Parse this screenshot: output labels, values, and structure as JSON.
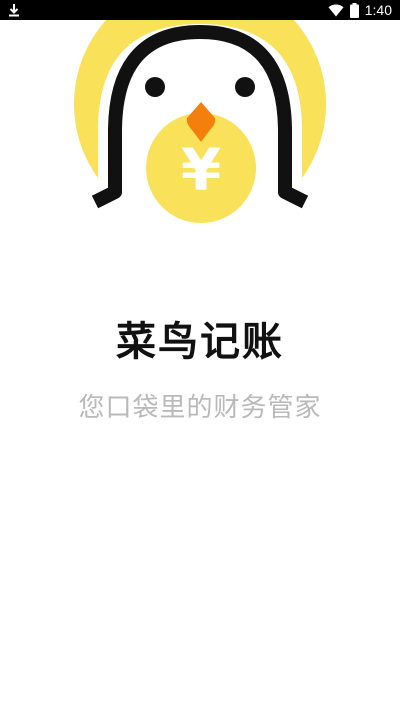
{
  "status_bar": {
    "time": "1:40",
    "icons": [
      "download-icon",
      "wifi-icon",
      "battery-icon"
    ]
  },
  "splash": {
    "logo_symbol": "¥",
    "app_name": "菜鸟记账",
    "slogan": "您口袋里的财务管家"
  },
  "colors": {
    "brand_yellow": "#f9e15a",
    "beak_orange": "#f57f0d",
    "outline_black": "#111111",
    "slogan_gray": "#b9b9b9"
  }
}
